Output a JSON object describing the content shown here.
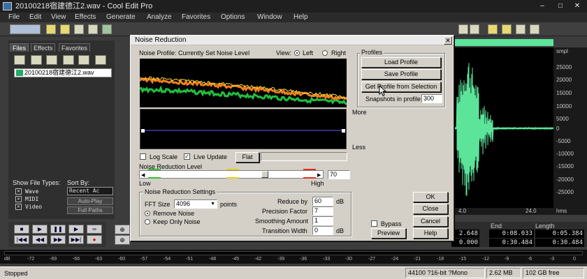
{
  "window": {
    "title": "20100218宿建德江2.wav - Cool Edit Pro",
    "minimize": "–",
    "maximize": "□",
    "close": "✕"
  },
  "menu": [
    "File",
    "Edit",
    "View",
    "Effects",
    "Generate",
    "Analyze",
    "Favorites",
    "Options",
    "Window",
    "Help"
  ],
  "left_panel": {
    "tabs": [
      "Files",
      "Effects",
      "Favorites"
    ],
    "file_item": "20100218宿建德江2.wav",
    "show_file_types_label": "Show File Types:",
    "sort_by_label": "Sort By:",
    "file_types": [
      {
        "checked": "✕",
        "label": "Wave"
      },
      {
        "checked": "✕",
        "label": "MIDI"
      },
      {
        "checked": "✕",
        "label": "Video"
      }
    ],
    "sort_value": "Recent Ac",
    "auto_play": "Auto-Play",
    "full_paths": "Full Paths"
  },
  "ruler": {
    "unit": "smpl",
    "labels": [
      "25000",
      "20000",
      "15000",
      "10000",
      "5000",
      "0",
      "-5000",
      "-10000",
      "-15000",
      "-20000",
      "-25000"
    ]
  },
  "timeline": {
    "first": "4.0",
    "second": "24.0",
    "unit": "hms"
  },
  "time_panel": {
    "headers": [
      "",
      "End",
      "Length"
    ],
    "row1": [
      "2.648",
      "0:08.033",
      "0:05.384"
    ],
    "row2": [
      "0.000",
      "0:30.484",
      "0:30.484"
    ]
  },
  "meter_ticks": [
    "dB",
    "-72",
    "-69",
    "-66",
    "-63",
    "-60",
    "-57",
    "-54",
    "-51",
    "-48",
    "-45",
    "-42",
    "-39",
    "-36",
    "-33",
    "-30",
    "-27",
    "-24",
    "-21",
    "-18",
    "-15",
    "-12",
    "-9",
    "-6",
    "-3",
    "0"
  ],
  "status": {
    "state": "Stopped",
    "format": "44100 ?16-bit ?Mono",
    "size": "2.62 MB",
    "free": "102 GB free"
  },
  "dialog": {
    "title": "Noise Reduction",
    "close": "✕",
    "noise_profile_label": "Noise Profile: Currently Set Noise Level",
    "view_label": "View:",
    "view_left": "Left",
    "view_right": "Right",
    "profiles_label": "Profiles",
    "load_profile": "Load Profile",
    "save_profile": "Save Profile",
    "get_profile": "Get Profile from Selection",
    "snapshots_label": "Snapshots in profile",
    "snapshots_value": "300",
    "more": "More",
    "less": "Less",
    "log_scale": "Log Scale",
    "live_update": "Live Update",
    "live_update_checked": "✓",
    "flat": "Flat",
    "level_label": "Noise Reduction Level",
    "level_value": "70",
    "low": "Low",
    "high": "High",
    "settings_label": "Noise Reduction Settings",
    "fft_label": "FFT Size",
    "fft_value": "4096",
    "points": "points",
    "remove_noise": "Remove Noise",
    "keep_only_noise": "Keep Only Noise",
    "reduce_by_label": "Reduce by",
    "reduce_by_value": "60",
    "reduce_by_unit": "dB",
    "precision_label": "Precision Factor",
    "precision_value": "7",
    "smoothing_label": "Smoothing Amount",
    "smoothing_value": "1",
    "transition_label": "Transition Width",
    "transition_value": "0",
    "transition_unit": "dB",
    "ok": "OK",
    "close_btn": "Close",
    "cancel": "Cancel",
    "bypass": "Bypass",
    "preview": "Preview",
    "help": "Help"
  },
  "colors": {
    "waveform": "#5ce49b",
    "noise_orange": "#f08020",
    "noise_green": "#20c040",
    "accent_blue": "#3a6ea5"
  }
}
